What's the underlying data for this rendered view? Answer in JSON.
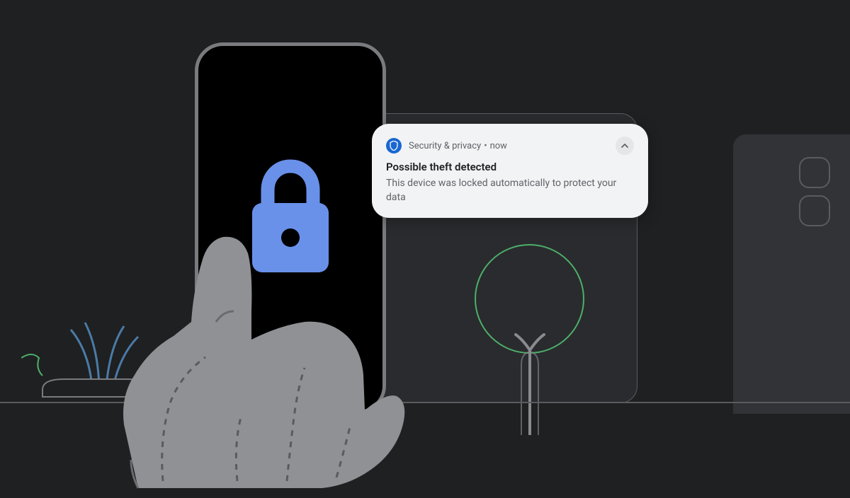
{
  "notification": {
    "source": "Security & privacy",
    "time": "now",
    "title": "Possible theft detected",
    "body": "This device was locked automatically to protect your data"
  },
  "colors": {
    "accent_blue": "#6991ea",
    "notif_bg": "#f1f3f4",
    "tree_green": "#4caf6a"
  }
}
